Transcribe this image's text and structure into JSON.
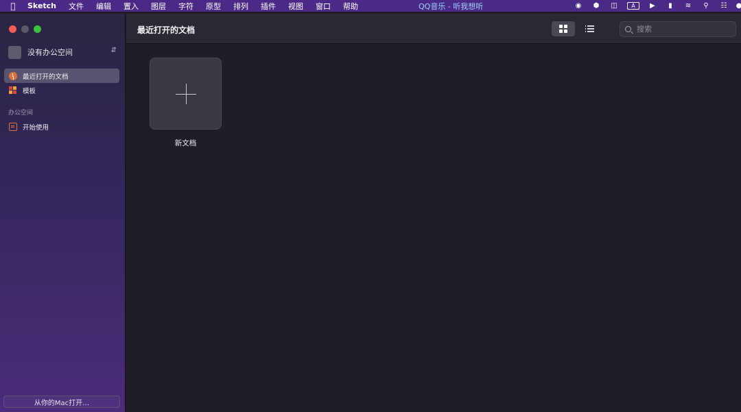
{
  "menubar": {
    "apple": "",
    "app_name": "Sketch",
    "menus": [
      "文件",
      "编辑",
      "置入",
      "图层",
      "字符",
      "原型",
      "排列",
      "插件",
      "视图",
      "窗口",
      "帮助"
    ],
    "now_playing": "QQ音乐 - 听我想听",
    "input_method": "A"
  },
  "sidebar": {
    "workspace_name": "没有办公空间",
    "workspace_chevron": "⌃⌄",
    "items": [
      {
        "label": "最近打开的文档",
        "icon": "clock-icon",
        "active": true
      },
      {
        "label": "模板",
        "icon": "templates-icon",
        "active": false
      }
    ],
    "section_heading": "办公空间",
    "section_items": [
      {
        "label": "开始使用",
        "icon": "document-icon"
      }
    ],
    "open_from_mac": "从你的Mac打开…"
  },
  "toolbar": {
    "title": "最近打开的文档",
    "search_placeholder": "搜索"
  },
  "documents": {
    "new_doc_label": "新文档"
  },
  "colors": {
    "menubar": "#4a2a86",
    "accent_orange": "#e0713a",
    "active_item": "#5a5370"
  }
}
